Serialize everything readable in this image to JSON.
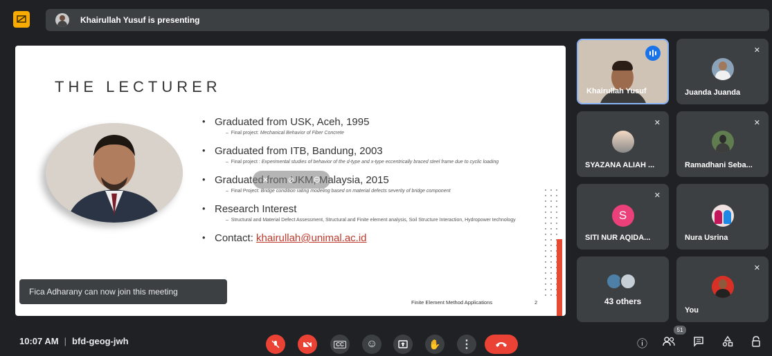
{
  "presenter_bar": {
    "text": "Khairullah Yusuf is presenting"
  },
  "slide": {
    "title": "THE LECTURER",
    "bullets": [
      {
        "main": "Graduated from USK, Aceh, 1995",
        "sub_prefix": "Final project: ",
        "sub_italic": "Mechanical Behavior of Fiber Concrete"
      },
      {
        "main": "Graduated from ITB, Bandung, 2003",
        "sub_prefix": "Final project : ",
        "sub_italic": "Experimental studies of behavior of the d-type and x-type eccentrically braced steel frame due to cyclic loading"
      },
      {
        "main": "Graduated from UKM, Malaysia, 2015",
        "sub_prefix": "Final Project: ",
        "sub_italic": "Bridge condition rating modeling based on material defects severity of bridge component"
      },
      {
        "main": "Research Interest",
        "sub_prefix": "Structural and Material Defect Assessment, Structural and Finite element analysis, Soil Structure Interaction, Hydropower technology",
        "sub_italic": ""
      }
    ],
    "contact_label": "Contact: ",
    "contact_email": "khairullah@unimal.ac.id",
    "footer": "Finite Element Method Applications",
    "page_number": "2"
  },
  "toast": {
    "text": "Fica Adharany can now join this meeting"
  },
  "participants": [
    {
      "name": "Khairullah Yusuf",
      "speaking": true
    },
    {
      "name": "Juanda Juanda",
      "muted": true
    },
    {
      "name": "SYAZANA ALIAH ...",
      "muted": true
    },
    {
      "name": "Ramadhani Seba...",
      "muted": true
    },
    {
      "name": "SITI NUR AQIDA...",
      "muted": true,
      "initial": "S",
      "avatar_color": "#ec407a"
    },
    {
      "name": "Nura Usrina"
    },
    {
      "name": "43 others"
    },
    {
      "name": "You",
      "muted": true
    }
  ],
  "bottom": {
    "time": "10:07 AM",
    "meeting_code": "bfd-geog-jwh",
    "people_count": "51"
  },
  "icons": {
    "mic_off": "🎙",
    "cam_off": "▣",
    "captions": "CC",
    "emoji": "☺",
    "present": "⬆",
    "hand": "✋",
    "more": "⋮",
    "hangup": "☎",
    "info": "ⓘ",
    "people": "👥",
    "chat": "▤",
    "activities": "△",
    "lock": "🔒",
    "mute_small": "✕"
  }
}
